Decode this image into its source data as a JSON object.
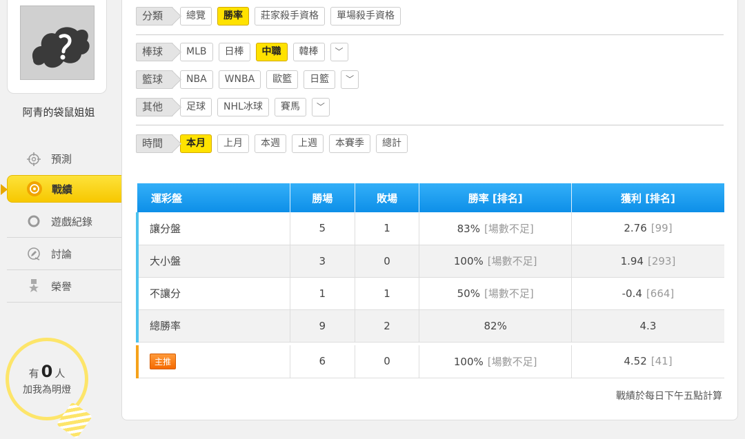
{
  "sidebar": {
    "user_name": "阿青的袋鼠姐姐",
    "nav": [
      {
        "label": "預測",
        "icon": "crosshair-icon"
      },
      {
        "label": "戰績",
        "icon": "target-icon"
      },
      {
        "label": "遊戲紀錄",
        "icon": "circle-icon"
      },
      {
        "label": "討論",
        "icon": "pencil-chat-icon"
      },
      {
        "label": "榮譽",
        "icon": "medal-icon"
      }
    ],
    "fans": {
      "prefix": "有",
      "count": "0",
      "suffix": "人",
      "line2": "加我為明燈"
    }
  },
  "filters": {
    "category": {
      "label": "分類",
      "chips": [
        "總覽",
        "勝率",
        "莊家殺手資格",
        "單場殺手資格"
      ],
      "selected": "勝率"
    },
    "baseball": {
      "label": "棒球",
      "chips": [
        "MLB",
        "日棒",
        "中職",
        "韓棒"
      ],
      "selected": "中職"
    },
    "basketball": {
      "label": "籃球",
      "chips": [
        "NBA",
        "WNBA",
        "歐籃",
        "日籃"
      ]
    },
    "other": {
      "label": "其他",
      "chips": [
        "足球",
        "NHL冰球",
        "賽馬"
      ]
    },
    "time": {
      "label": "時間",
      "chips": [
        "本月",
        "上月",
        "本週",
        "上週",
        "本賽季",
        "總計"
      ],
      "selected": "本月"
    },
    "dropdown_glyph": "﹀"
  },
  "table": {
    "headers": [
      "運彩盤",
      "勝場",
      "敗場",
      "勝率 [排名]",
      "獲利 [排名]"
    ],
    "rows": [
      {
        "name": "讓分盤",
        "win": "5",
        "lose": "1",
        "rate": "83%",
        "rate_rank": "[場數不足]",
        "profit": "2.76",
        "profit_rank": "[99]"
      },
      {
        "name": "大小盤",
        "win": "3",
        "lose": "0",
        "rate": "100%",
        "rate_rank": "[場數不足]",
        "profit": "1.94",
        "profit_rank": "[293]"
      },
      {
        "name": "不讓分",
        "win": "1",
        "lose": "1",
        "rate": "50%",
        "rate_rank": "[場數不足]",
        "profit": "-0.4",
        "profit_rank": "[664]"
      },
      {
        "name": "總勝率",
        "win": "9",
        "lose": "2",
        "rate": "82%",
        "rate_rank": "",
        "profit": "4.3",
        "profit_rank": ""
      }
    ],
    "main_pick": {
      "tag": "主推",
      "win": "6",
      "lose": "0",
      "rate": "100%",
      "rate_rank": "[場數不足]",
      "profit": "4.52",
      "profit_rank": "[41]"
    }
  },
  "note": "戰績於每日下午五點計算",
  "colors": {
    "accent_yellow": "#ffe200",
    "header_blue": "#1c9bf0",
    "tag_orange": "#f56a00"
  }
}
